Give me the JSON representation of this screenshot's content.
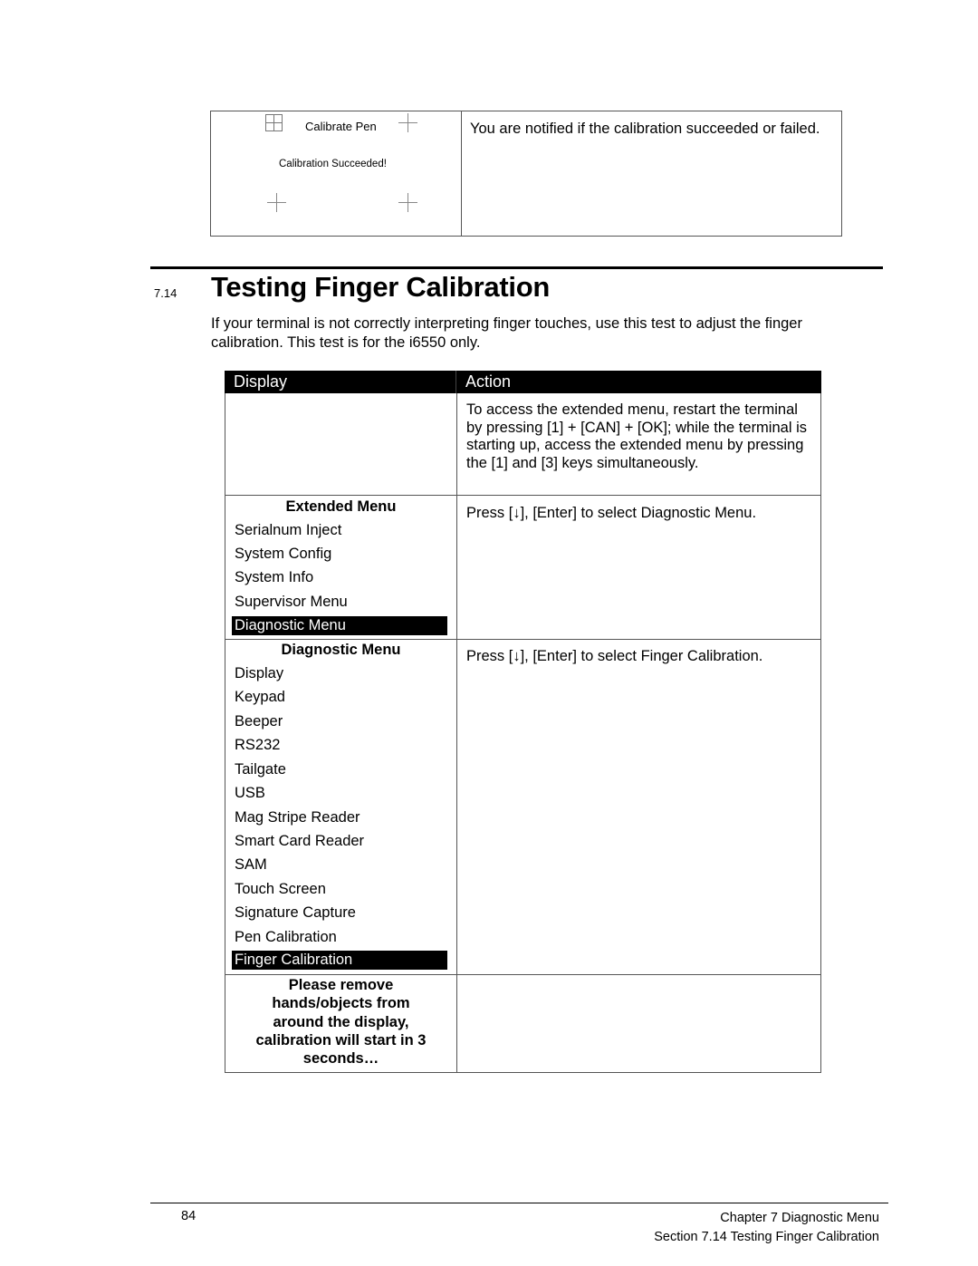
{
  "calibration_example": {
    "display": {
      "icons": [
        "grid-icon",
        "crosshair-icon",
        "crosshair-icon",
        "crosshair-icon"
      ],
      "title": "Calibrate Pen",
      "status": "Calibration Succeeded!"
    },
    "action": "You are notified if the calibration succeeded or failed."
  },
  "section": {
    "number": "7.14",
    "title": "Testing Finger Calibration",
    "intro": "If your terminal is not correctly interpreting finger touches, use this test to adjust the finger calibration. This test is for the i6550 only."
  },
  "table": {
    "headers": {
      "display": "Display",
      "action": "Action"
    },
    "rows": [
      {
        "display": null,
        "action": "To access the extended menu, restart the terminal by pressing [1] + [CAN] + [OK]; while the terminal is starting up, access the extended menu by pressing the [1] and [3] keys simultaneously."
      },
      {
        "display": {
          "title": "Extended Menu",
          "items": [
            "Serialnum Inject",
            "System Config",
            "System Info",
            "Supervisor Menu",
            "Diagnostic Menu"
          ],
          "selected": "Diagnostic Menu"
        },
        "action": "Press [↓], [Enter] to select Diagnostic Menu."
      },
      {
        "display": {
          "title": "Diagnostic Menu",
          "items": [
            "Display",
            "Keypad",
            "Beeper",
            "RS232",
            "Tailgate",
            "USB",
            "Mag Stripe Reader",
            "Smart Card Reader",
            "SAM",
            "Touch Screen",
            "Signature Capture",
            "Pen Calibration",
            "Finger Calibration"
          ],
          "selected": "Finger Calibration"
        },
        "action": "Press [↓], [Enter] to select Finger Calibration."
      },
      {
        "display": {
          "prompt_lines": [
            "Please remove",
            "hands/objects from",
            "around the display,",
            "calibration will start in 3",
            "seconds…"
          ]
        },
        "action": ""
      }
    ]
  },
  "footer": {
    "page_number": "84",
    "chapter": "Chapter 7 Diagnostic Menu",
    "section": "Section 7.14 Testing Finger Calibration"
  }
}
